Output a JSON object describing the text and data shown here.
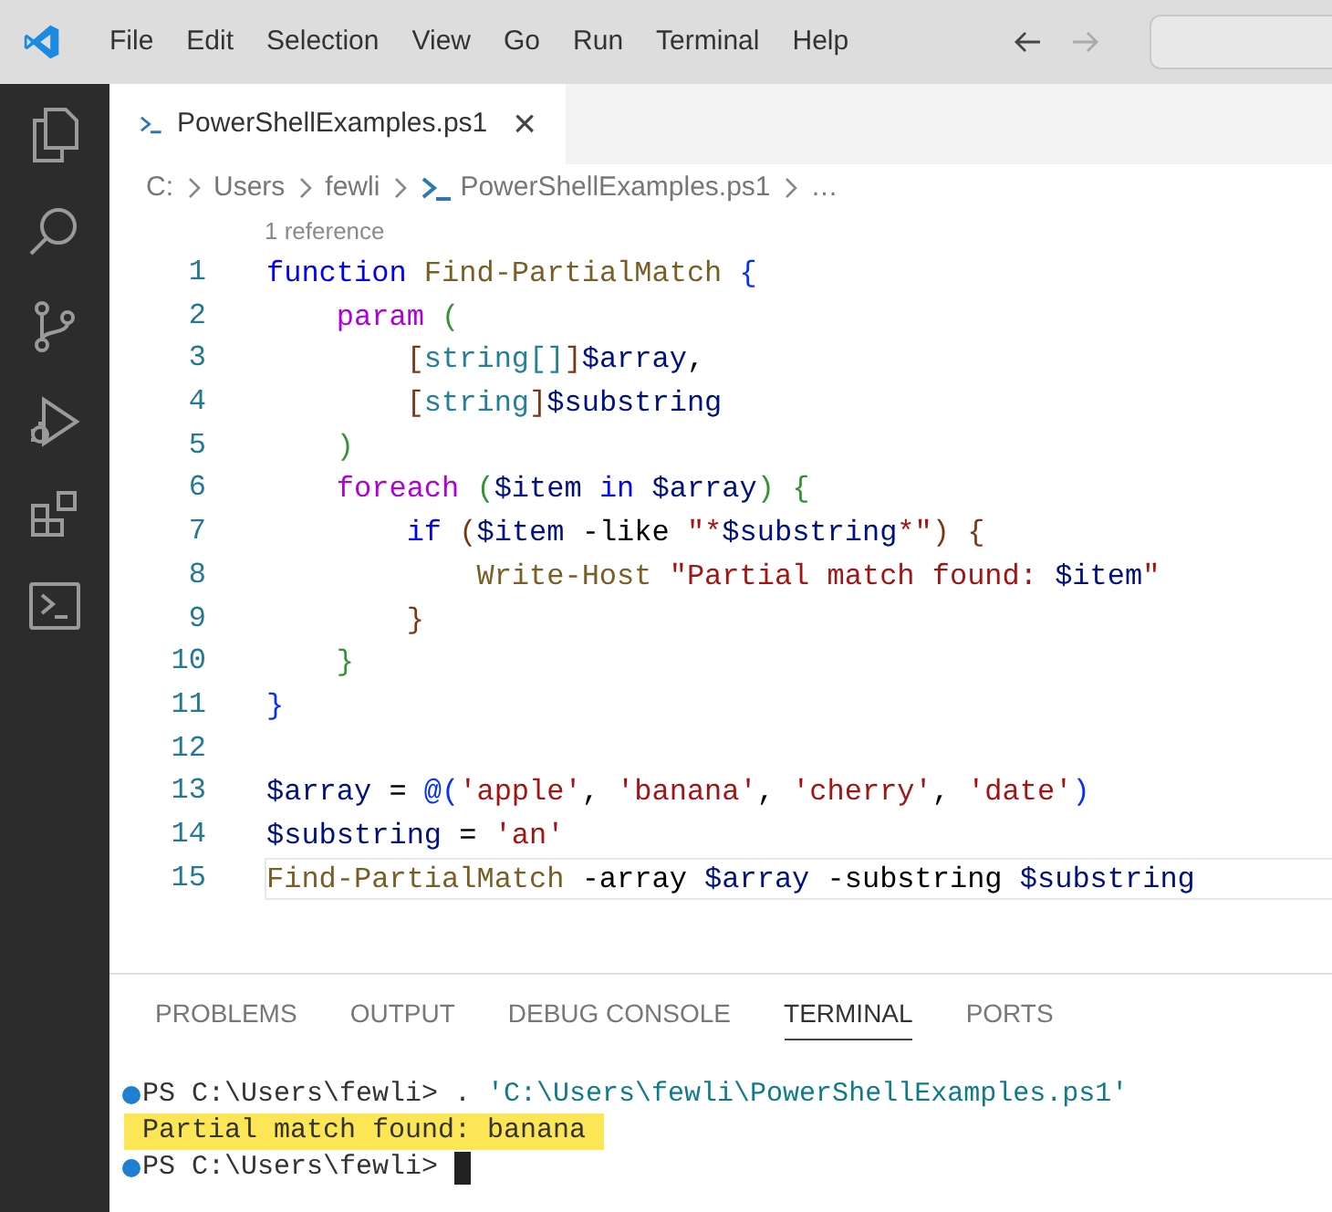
{
  "menu": [
    "File",
    "Edit",
    "Selection",
    "View",
    "Go",
    "Run",
    "Terminal",
    "Help"
  ],
  "navigation": {
    "back_disabled": false,
    "forward_disabled": true
  },
  "tab": {
    "label": "PowerShellExamples.ps1",
    "close": "×"
  },
  "breadcrumb": [
    "C:",
    "Users",
    "fewli",
    "PowerShellExamples.ps1",
    "…"
  ],
  "codelens": "1 reference",
  "code_lines": [
    {
      "number": "1",
      "current": false,
      "tokens": [
        {
          "text": "function ",
          "kind": "keyword"
        },
        {
          "text": "Find-PartialMatch ",
          "kind": "function"
        },
        {
          "text": "{",
          "kind": "bracket1"
        }
      ]
    },
    {
      "number": "2",
      "current": false,
      "tokens": [
        {
          "text": "    param ",
          "kind": "control"
        },
        {
          "text": "(",
          "kind": "bracket2"
        }
      ]
    },
    {
      "number": "3",
      "current": false,
      "tokens": [
        {
          "text": "        [",
          "kind": "bracket3"
        },
        {
          "text": "string[]",
          "kind": "type"
        },
        {
          "text": "]",
          "kind": "bracket3"
        },
        {
          "text": "$array",
          "kind": "variable"
        },
        {
          "text": ",",
          "kind": "plain"
        }
      ]
    },
    {
      "number": "4",
      "current": false,
      "tokens": [
        {
          "text": "        [",
          "kind": "bracket3"
        },
        {
          "text": "string",
          "kind": "type"
        },
        {
          "text": "]",
          "kind": "bracket3"
        },
        {
          "text": "$substring",
          "kind": "variable"
        }
      ]
    },
    {
      "number": "5",
      "current": false,
      "tokens": [
        {
          "text": "    )",
          "kind": "bracket2"
        }
      ]
    },
    {
      "number": "6",
      "current": false,
      "tokens": [
        {
          "text": "    foreach ",
          "kind": "control"
        },
        {
          "text": "(",
          "kind": "bracket2"
        },
        {
          "text": "$item ",
          "kind": "variable"
        },
        {
          "text": "in ",
          "kind": "keyword"
        },
        {
          "text": "$array",
          "kind": "variable"
        },
        {
          "text": ") {",
          "kind": "bracket2"
        }
      ]
    },
    {
      "number": "7",
      "current": false,
      "tokens": [
        {
          "text": "        if ",
          "kind": "keyword"
        },
        {
          "text": "(",
          "kind": "bracket3"
        },
        {
          "text": "$item ",
          "kind": "variable"
        },
        {
          "text": "-like ",
          "kind": "plain"
        },
        {
          "text": "\"*",
          "kind": "string"
        },
        {
          "text": "$substring",
          "kind": "variable"
        },
        {
          "text": "*\"",
          "kind": "string"
        },
        {
          "text": ") {",
          "kind": "bracket3"
        }
      ]
    },
    {
      "number": "8",
      "current": false,
      "tokens": [
        {
          "text": "            Write-Host ",
          "kind": "function"
        },
        {
          "text": "\"Partial match found: ",
          "kind": "string"
        },
        {
          "text": "$item",
          "kind": "variable"
        },
        {
          "text": "\"",
          "kind": "string"
        }
      ]
    },
    {
      "number": "9",
      "current": false,
      "tokens": [
        {
          "text": "        }",
          "kind": "bracket3"
        }
      ]
    },
    {
      "number": "10",
      "current": false,
      "tokens": [
        {
          "text": "    }",
          "kind": "bracket2"
        }
      ]
    },
    {
      "number": "11",
      "current": false,
      "tokens": [
        {
          "text": "}",
          "kind": "bracket1"
        }
      ]
    },
    {
      "number": "12",
      "current": false
    },
    {
      "number": "13",
      "current": false,
      "tokens": [
        {
          "text": "$array ",
          "kind": "variable"
        },
        {
          "text": "= ",
          "kind": "plain"
        },
        {
          "text": "@(",
          "kind": "bracket1"
        },
        {
          "text": "'apple'",
          "kind": "string"
        },
        {
          "text": ", ",
          "kind": "plain"
        },
        {
          "text": "'banana'",
          "kind": "string"
        },
        {
          "text": ", ",
          "kind": "plain"
        },
        {
          "text": "'cherry'",
          "kind": "string"
        },
        {
          "text": ", ",
          "kind": "plain"
        },
        {
          "text": "'date'",
          "kind": "string"
        },
        {
          "text": ")",
          "kind": "bracket1"
        }
      ]
    },
    {
      "number": "14",
      "current": false,
      "tokens": [
        {
          "text": "$substring ",
          "kind": "variable"
        },
        {
          "text": "= ",
          "kind": "plain"
        },
        {
          "text": "'an'",
          "kind": "string"
        }
      ]
    },
    {
      "number": "15",
      "current": true,
      "tokens": [
        {
          "text": "Find-PartialMatch ",
          "kind": "function"
        },
        {
          "text": "-array ",
          "kind": "plain"
        },
        {
          "text": "$array ",
          "kind": "variable"
        },
        {
          "text": "-substring ",
          "kind": "plain"
        },
        {
          "text": "$substring",
          "kind": "variable"
        }
      ]
    }
  ],
  "panel_tabs": [
    {
      "label": "PROBLEMS",
      "selected": false
    },
    {
      "label": "OUTPUT",
      "selected": false
    },
    {
      "label": "DEBUG CONSOLE",
      "selected": false
    },
    {
      "label": "TERMINAL",
      "selected": true
    },
    {
      "label": "PORTS",
      "selected": false
    }
  ],
  "terminal_lines": [
    {
      "kind": "prompt",
      "highlighted": false,
      "cursor": false,
      "tokens": [
        {
          "text": "PS C:\\Users\\fewli> . ",
          "kind": "plain"
        },
        {
          "text": "'C:\\Users\\fewli\\PowerShellExamples.ps1'",
          "kind": "path"
        }
      ]
    },
    {
      "kind": "output",
      "highlighted": true,
      "cursor": false,
      "tokens": [
        {
          "text": "Partial match found: banana",
          "kind": "plain"
        }
      ]
    },
    {
      "kind": "prompt",
      "highlighted": false,
      "cursor": true,
      "tokens": [
        {
          "text": "PS C:\\Users\\fewli> ",
          "kind": "plain"
        }
      ]
    }
  ]
}
